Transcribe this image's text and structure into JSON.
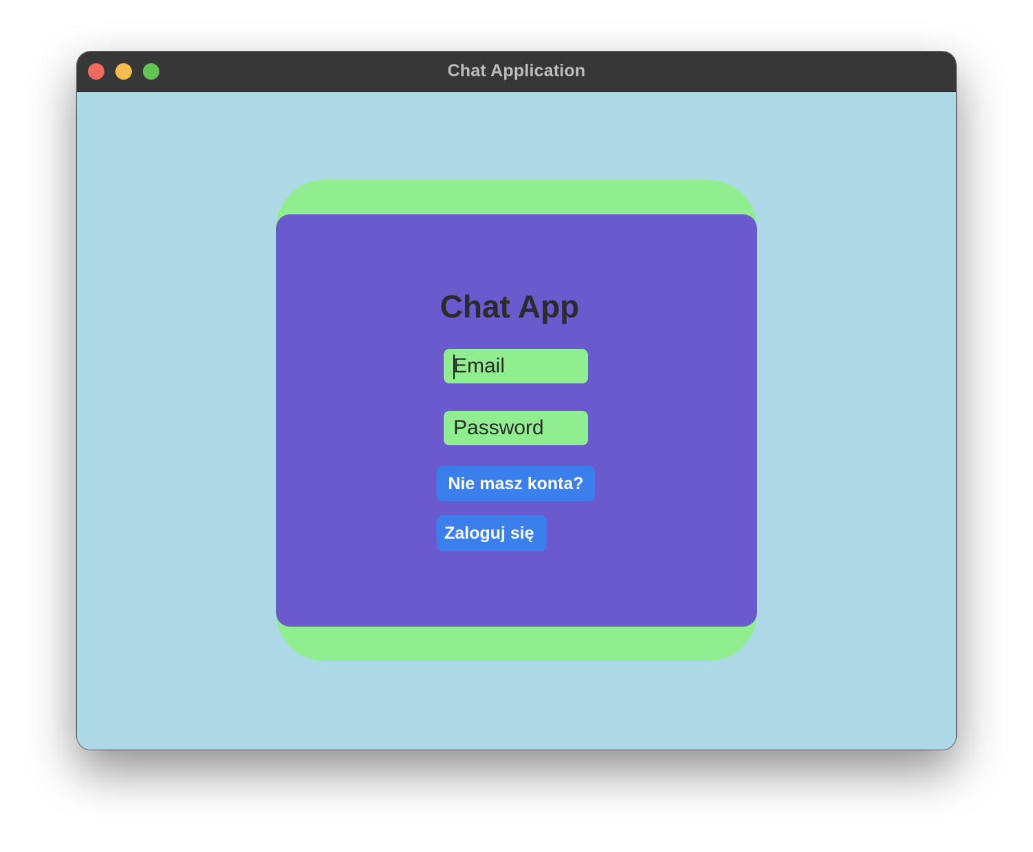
{
  "window": {
    "title": "Chat Application",
    "controls": {
      "close_color": "#ee6a5e",
      "minimize_color": "#f5bd4f",
      "maximize_color": "#61c454"
    }
  },
  "colors": {
    "background": "#add8e6",
    "card_outer": "#90ee90",
    "card_inner": "#6a5acd",
    "field": "#90ee90",
    "button": "#3a7fec"
  },
  "login": {
    "title": "Chat App",
    "email_placeholder": "Email",
    "email_value": "",
    "password_placeholder": "Password",
    "password_value": "",
    "register_label": "Nie masz konta?",
    "login_label": "Zaloguj się"
  }
}
